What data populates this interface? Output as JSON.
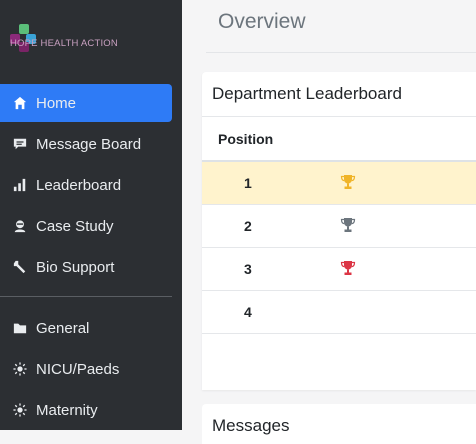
{
  "brand": {
    "name": "HOPE HEALTH ACTION"
  },
  "sidebar": {
    "items": [
      {
        "label": "Home",
        "icon": "home-icon",
        "active": true
      },
      {
        "label": "Message Board",
        "icon": "message-icon"
      },
      {
        "label": "Leaderboard",
        "icon": "bar-chart-icon"
      },
      {
        "label": "Case Study",
        "icon": "user-secret-icon"
      },
      {
        "label": "Bio Support",
        "icon": "wrench-icon"
      }
    ],
    "sections": [
      {
        "label": "General",
        "icon": "folder-icon"
      },
      {
        "label": "NICU/Paeds",
        "icon": "sun-icon"
      },
      {
        "label": "Maternity",
        "icon": "sun-icon"
      }
    ],
    "active_color": "#2e7bf6"
  },
  "page": {
    "title": "Overview"
  },
  "leaderboard": {
    "title": "Department Leaderboard",
    "column_position": "Position",
    "rows": [
      {
        "position": "1",
        "trophy": "gold",
        "color": "#f0b429"
      },
      {
        "position": "2",
        "trophy": "silver",
        "color": "#6c757d"
      },
      {
        "position": "3",
        "trophy": "bronze",
        "color": "#dc3545"
      },
      {
        "position": "4",
        "trophy": "",
        "color": ""
      }
    ],
    "highlight_color": "#fff3cd"
  },
  "messages": {
    "title": "Messages"
  }
}
